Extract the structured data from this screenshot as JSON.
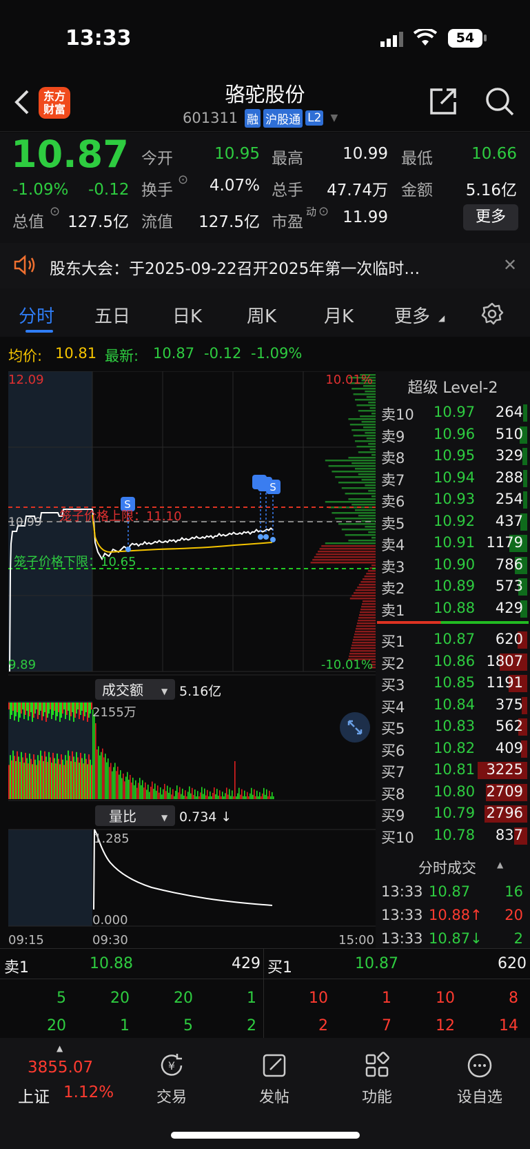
{
  "status_bar": {
    "time": "13:33",
    "battery": "54"
  },
  "header": {
    "logo_line1": "东方",
    "logo_line2": "财富",
    "title": "骆驼股份",
    "code": "601311",
    "badges": [
      "融",
      "沪股通",
      "L2"
    ]
  },
  "quote": {
    "price": "10.87",
    "change_pct": "-1.09%",
    "change": "-0.12",
    "stats": [
      {
        "label": "今开",
        "value": "10.95",
        "color": "green"
      },
      {
        "label": "最高",
        "value": "10.99",
        "color": "white"
      },
      {
        "label": "最低",
        "value": "10.66",
        "color": "green"
      },
      {
        "label": "换手",
        "value": "4.07%",
        "color": "white"
      },
      {
        "label": "总手",
        "value": "47.74万",
        "color": "white"
      },
      {
        "label": "金额",
        "value": "5.16亿",
        "color": "white"
      },
      {
        "label": "总值",
        "value": "127.5亿",
        "color": "white"
      },
      {
        "label": "流值",
        "value": "127.5亿",
        "color": "white"
      },
      {
        "label": "市盈",
        "value": "11.99",
        "color": "white"
      }
    ],
    "pe_sup": "动",
    "more_label": "更多"
  },
  "notice": {
    "text": "股东大会：于2025-09-22召开2025年第一次临时…"
  },
  "tabs": [
    "分时",
    "五日",
    "日K",
    "周K",
    "月K",
    "更多"
  ],
  "avg_line": {
    "avg_label": "均价:",
    "avg_value": "10.81",
    "latest_label": "最新:",
    "latest_value": "10.87",
    "change": "-0.12",
    "change_pct": "-1.09%"
  },
  "chart": {
    "price_top": "12.09",
    "price_bottom": "9.89",
    "pct_top": "10.01%",
    "pct_bottom": "-10.01%",
    "upper_limit_label": "笼子价格上限：11.10",
    "lower_limit_label": "笼子价格下限：10.65",
    "prev_close_label": "10.99",
    "volume_selector": "成交额",
    "volume_total": "5.16亿",
    "volume_peak": "2155万",
    "ratio_selector": "量比",
    "ratio_value": "0.734 ↓",
    "ratio_max": "1.285",
    "ratio_min": "0.000",
    "time_start": "09:15",
    "time_open": "09:30",
    "time_end": "15:00",
    "signal_marker": "S"
  },
  "orderbook": {
    "title": "超级 Level-2",
    "asks": [
      {
        "label": "卖10",
        "price": "10.97",
        "vol": "264"
      },
      {
        "label": "卖9",
        "price": "10.96",
        "vol": "510"
      },
      {
        "label": "卖8",
        "price": "10.95",
        "vol": "329"
      },
      {
        "label": "卖7",
        "price": "10.94",
        "vol": "288"
      },
      {
        "label": "卖6",
        "price": "10.93",
        "vol": "254"
      },
      {
        "label": "卖5",
        "price": "10.92",
        "vol": "437"
      },
      {
        "label": "卖4",
        "price": "10.91",
        "vol": "1179"
      },
      {
        "label": "卖3",
        "price": "10.90",
        "vol": "786"
      },
      {
        "label": "卖2",
        "price": "10.89",
        "vol": "573"
      },
      {
        "label": "卖1",
        "price": "10.88",
        "vol": "429"
      }
    ],
    "bids": [
      {
        "label": "买1",
        "price": "10.87",
        "vol": "620"
      },
      {
        "label": "买2",
        "price": "10.86",
        "vol": "1807"
      },
      {
        "label": "买3",
        "price": "10.85",
        "vol": "1191"
      },
      {
        "label": "买4",
        "price": "10.84",
        "vol": "375"
      },
      {
        "label": "买5",
        "price": "10.83",
        "vol": "562"
      },
      {
        "label": "买6",
        "price": "10.82",
        "vol": "409"
      },
      {
        "label": "买7",
        "price": "10.81",
        "vol": "3225"
      },
      {
        "label": "买8",
        "price": "10.80",
        "vol": "2709"
      },
      {
        "label": "买9",
        "price": "10.79",
        "vol": "2796"
      },
      {
        "label": "买10",
        "price": "10.78",
        "vol": "837"
      }
    ],
    "ticks_title": "分时成交",
    "ticks": [
      {
        "time": "13:33",
        "price": "10.87",
        "vol": "16",
        "color": "green"
      },
      {
        "time": "13:33",
        "price": "10.88↑",
        "vol": "20",
        "color": "red"
      },
      {
        "time": "13:33",
        "price": "10.87↓",
        "vol": "2",
        "color": "green"
      }
    ]
  },
  "bottom_queue": {
    "sell_label": "卖1",
    "sell_price": "10.88",
    "sell_vol": "429",
    "buy_label": "买1",
    "buy_price": "10.87",
    "buy_vol": "620",
    "sell_row1": [
      "5",
      "20",
      "20",
      "1"
    ],
    "sell_row2": [
      "20",
      "1",
      "5",
      "2"
    ],
    "buy_row1": [
      "10",
      "1",
      "10",
      "8"
    ],
    "buy_row2": [
      "2",
      "7",
      "12",
      "14"
    ]
  },
  "nav": {
    "index_value": "3855.07",
    "index_name": "上证",
    "index_pct": "1.12%",
    "items": [
      "交易",
      "发帖",
      "功能",
      "设自选"
    ]
  }
}
